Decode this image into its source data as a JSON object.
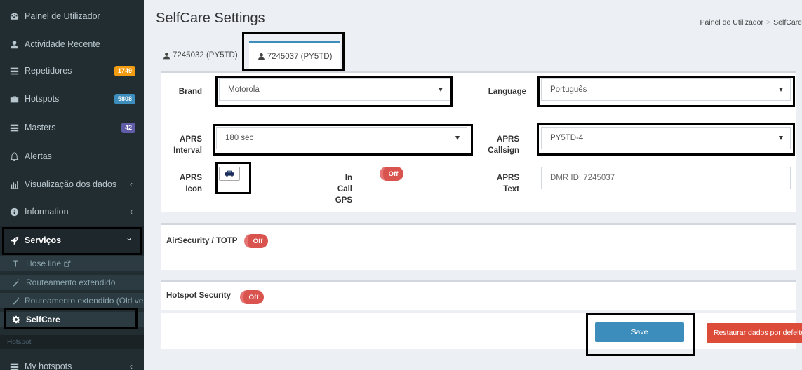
{
  "sidebar": {
    "items": [
      {
        "label": "Painel de Utilizador",
        "icon": "dashboard-icon"
      },
      {
        "label": "Actividade Recente",
        "icon": "user-icon"
      },
      {
        "label": "Repetidores",
        "icon": "list-icon",
        "badge": "1749"
      },
      {
        "label": "Hotspots",
        "icon": "briefcase-icon",
        "badge": "5808"
      },
      {
        "label": "Masters",
        "icon": "list-icon",
        "badge": "42"
      },
      {
        "label": "Alertas",
        "icon": "bell-icon"
      },
      {
        "label": "Visualização dos dados",
        "icon": "bar-chart-icon",
        "chevron": "‹"
      },
      {
        "label": "Information",
        "icon": "info-icon",
        "chevron": "‹"
      },
      {
        "label": "Serviços",
        "icon": "rocket-icon",
        "chevron": "⌄"
      },
      {
        "label": "My hotspots",
        "icon": "list-icon",
        "chevron": "‹"
      }
    ],
    "subitems": [
      {
        "label": "Hose line",
        "icon": "hose-icon"
      },
      {
        "label": "Routeamento extendido",
        "icon": "magic-wand-icon"
      },
      {
        "label": "Routeamento extendido (Old version)",
        "icon": "magic-wand-icon"
      },
      {
        "label": "SelfCare",
        "icon": "gear-icon"
      }
    ],
    "section_header": "Hotspot"
  },
  "page": {
    "title": "SelfCare Settings",
    "breadcrumb": [
      "Painel de Utilizador",
      "SelfCare"
    ],
    "breadcrumb_sep": ">"
  },
  "tabs": [
    {
      "label": "7245032 (PY5TD)"
    },
    {
      "label": "7245037 (PY5TD)"
    }
  ],
  "form": {
    "brand_label": "Brand",
    "brand_value": "Motorola",
    "language_label": "Language",
    "language_value": "Português",
    "aprs_interval_label1": "APRS",
    "aprs_interval_label2": "Interval",
    "aprs_interval_value": "180 sec",
    "aprs_callsign_label1": "APRS",
    "aprs_callsign_label2": "Callsign",
    "aprs_callsign_value": "PY5TD-4",
    "aprs_icon_label1": "APRS",
    "aprs_icon_label2": "Icon",
    "in_call_gps_label1": "In Call",
    "in_call_gps_label2": "GPS",
    "in_call_gps_state": "Off",
    "aprs_text_label1": "APRS",
    "aprs_text_label2": "Text",
    "aprs_text_placeholder": "DMR ID: 7245037"
  },
  "airsecurity": {
    "label": "AirSecurity / TOTP",
    "state": "Off"
  },
  "hotspot_security": {
    "label": "Hotspot Security",
    "state": "Off"
  },
  "actions": {
    "save_label": "Save",
    "restore_label": "Restaurar dados por defeito"
  },
  "colors": {
    "sidebar_bg": "#222d32",
    "accent": "#3c8dbc",
    "danger": "#dd4b39",
    "badge_orange": "#f39c12",
    "badge_purple": "#605ca8"
  }
}
